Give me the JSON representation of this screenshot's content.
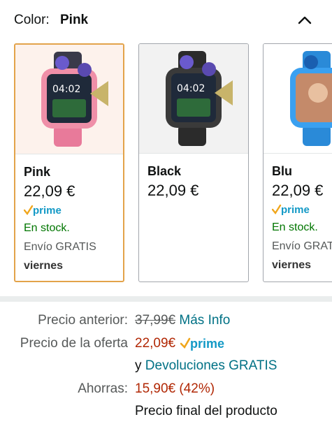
{
  "color_selector": {
    "label": "Color:",
    "selected": "Pink"
  },
  "swatches": [
    {
      "name": "Pink",
      "price": "22,09 €",
      "prime": true,
      "stock": "En stock.",
      "shipping": "Envío GRATIS",
      "delivery": "viernes"
    },
    {
      "name": "Black",
      "price": "22,09 €",
      "prime": false,
      "stock": "",
      "shipping": "",
      "delivery": ""
    },
    {
      "name": "Blu",
      "price": "22,09 €",
      "prime": true,
      "stock": "En stock.",
      "shipping": "Envío GRATIS",
      "delivery": "viernes"
    }
  ],
  "prime_label": "prime",
  "pricing": {
    "previous_label": "Precio anterior:",
    "previous_value": "37,99€",
    "more_info": "Más Info",
    "offer_label": "Precio de la oferta",
    "offer_value": "22,09€",
    "returns_prefix": "y",
    "returns_link": "Devoluciones GRATIS",
    "savings_label": "Ahorras:",
    "savings_value": "15,90€ (42%)",
    "final_note": "Precio final del producto"
  },
  "colors": {
    "accent_selected": "#e3a34a",
    "stock_green": "#007600",
    "link_teal": "#007185",
    "deal_red": "#b12704",
    "prime_blue": "#1399c6",
    "prime_check": "#f0a61c"
  }
}
